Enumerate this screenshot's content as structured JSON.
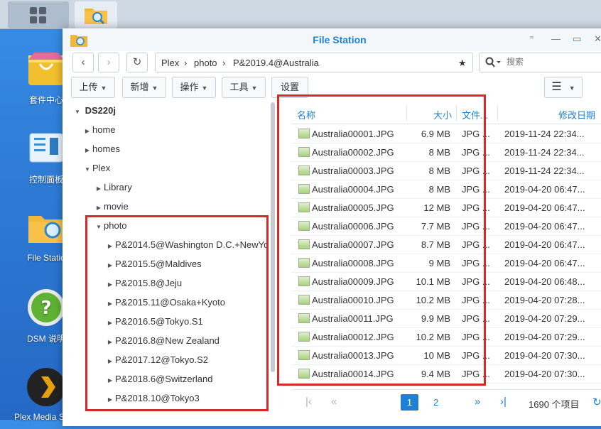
{
  "desktop": {
    "items": [
      {
        "label": "套件中心",
        "icon": "package-center-icon"
      },
      {
        "label": "控制面板",
        "icon": "control-panel-icon"
      },
      {
        "label": "File Statio",
        "icon": "file-station-icon"
      },
      {
        "label": "DSM 说明",
        "icon": "help-icon"
      },
      {
        "label": "Plex Media Server",
        "icon": "plex-icon"
      }
    ]
  },
  "window": {
    "title": "File Station",
    "controls": {
      "pin": "⁼",
      "minimize": "—",
      "maximize": "▭",
      "close": "✕"
    }
  },
  "toolbar": {
    "back": "‹",
    "forward": "›",
    "refresh": "↻",
    "breadcrumb": [
      "Plex",
      "photo",
      "P&2019.4@Australia"
    ],
    "search_placeholder": "搜索"
  },
  "actions": [
    {
      "label": "上传",
      "dropdown": true
    },
    {
      "label": "新增",
      "dropdown": true
    },
    {
      "label": "操作",
      "dropdown": true
    },
    {
      "label": "工具",
      "dropdown": true
    },
    {
      "label": "设置",
      "dropdown": false
    }
  ],
  "tree": {
    "root": "DS220j",
    "nodes": [
      {
        "label": "home",
        "expanded": false,
        "level": 1
      },
      {
        "label": "homes",
        "expanded": false,
        "level": 1
      },
      {
        "label": "Plex",
        "expanded": true,
        "level": 1
      },
      {
        "label": "Library",
        "expanded": false,
        "level": 2
      },
      {
        "label": "movie",
        "expanded": false,
        "level": 2
      },
      {
        "label": "photo",
        "expanded": true,
        "level": 2
      },
      {
        "label": "P&2014.5@Washington D.C.+NewYo",
        "expanded": false,
        "level": 3
      },
      {
        "label": "P&2015.5@Maldives",
        "expanded": false,
        "level": 3
      },
      {
        "label": "P&2015.8@Jeju",
        "expanded": false,
        "level": 3
      },
      {
        "label": "P&2015.11@Osaka+Kyoto",
        "expanded": false,
        "level": 3
      },
      {
        "label": "P&2016.5@Tokyo.S1",
        "expanded": false,
        "level": 3
      },
      {
        "label": "P&2016.8@New Zealand",
        "expanded": false,
        "level": 3
      },
      {
        "label": "P&2017.12@Tokyo.S2",
        "expanded": false,
        "level": 3
      },
      {
        "label": "P&2018.6@Switzerland",
        "expanded": false,
        "level": 3
      },
      {
        "label": "P&2018.10@Tokyo3",
        "expanded": false,
        "level": 3
      }
    ]
  },
  "list": {
    "columns": {
      "name": "名称",
      "size": "大小",
      "type": "文件...",
      "modified": "修改日期"
    },
    "rows": [
      {
        "name": "Australia00001.JPG",
        "size": "6.9 MB",
        "type": "JPG ...",
        "modified": "2019-11-24 22:34..."
      },
      {
        "name": "Australia00002.JPG",
        "size": "8 MB",
        "type": "JPG ...",
        "modified": "2019-11-24 22:34..."
      },
      {
        "name": "Australia00003.JPG",
        "size": "8 MB",
        "type": "JPG ...",
        "modified": "2019-11-24 22:34..."
      },
      {
        "name": "Australia00004.JPG",
        "size": "8 MB",
        "type": "JPG ...",
        "modified": "2019-04-20 06:47..."
      },
      {
        "name": "Australia00005.JPG",
        "size": "12 MB",
        "type": "JPG ...",
        "modified": "2019-04-20 06:47..."
      },
      {
        "name": "Australia00006.JPG",
        "size": "7.7 MB",
        "type": "JPG ...",
        "modified": "2019-04-20 06:47..."
      },
      {
        "name": "Australia00007.JPG",
        "size": "8.7 MB",
        "type": "JPG ...",
        "modified": "2019-04-20 06:47..."
      },
      {
        "name": "Australia00008.JPG",
        "size": "9 MB",
        "type": "JPG ...",
        "modified": "2019-04-20 06:47..."
      },
      {
        "name": "Australia00009.JPG",
        "size": "10.1 MB",
        "type": "JPG ...",
        "modified": "2019-04-20 06:48..."
      },
      {
        "name": "Australia00010.JPG",
        "size": "10.2 MB",
        "type": "JPG ...",
        "modified": "2019-04-20 07:28..."
      },
      {
        "name": "Australia00011.JPG",
        "size": "9.9 MB",
        "type": "JPG ...",
        "modified": "2019-04-20 07:29..."
      },
      {
        "name": "Australia00012.JPG",
        "size": "10.2 MB",
        "type": "JPG ...",
        "modified": "2019-04-20 07:29..."
      },
      {
        "name": "Australia00013.JPG",
        "size": "10 MB",
        "type": "JPG ...",
        "modified": "2019-04-20 07:30..."
      },
      {
        "name": "Australia00014.JPG",
        "size": "9.4 MB",
        "type": "JPG ...",
        "modified": "2019-04-20 07:30..."
      }
    ]
  },
  "pager": {
    "first": "|‹",
    "prev": "«",
    "pages": [
      "1",
      "2"
    ],
    "current_page": "1",
    "next": "»",
    "last": "›|",
    "total": "1690 个项目"
  },
  "colors": {
    "accent": "#1e7fd3",
    "annotation": "#d42a2a"
  }
}
